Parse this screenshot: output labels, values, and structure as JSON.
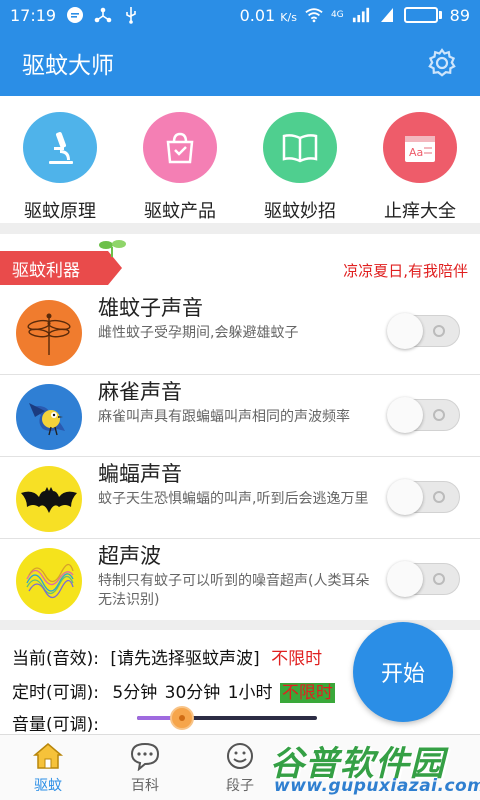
{
  "status_bar": {
    "time": "17:19",
    "speed": "0.01",
    "speed_unit": "K/s",
    "network": "4G",
    "battery_level": 89,
    "battery_text": "89"
  },
  "app_bar": {
    "title": "驱蚊大师"
  },
  "quick_menu": [
    {
      "label": "驱蚊原理",
      "icon": "microscope-icon",
      "color": "#4fb3ea"
    },
    {
      "label": "驱蚊产品",
      "icon": "shopping-bag-icon",
      "color": "#f47fb4"
    },
    {
      "label": "驱蚊妙招",
      "icon": "open-book-icon",
      "color": "#4fcf8f"
    },
    {
      "label": "止痒大全",
      "icon": "notepad-icon",
      "color": "#ee5c6a"
    }
  ],
  "section": {
    "ribbon_label": "驱蚊利器",
    "slogan": "凉凉夏日,有我陪伴",
    "items": [
      {
        "name": "雄蚊子声音",
        "description": "雌性蚊子受孕期间,会躲避雄蚊子",
        "icon": "dragonfly-icon",
        "on": false
      },
      {
        "name": "麻雀声音",
        "description": "麻雀叫声具有跟蝙蝠叫声相同的声波频率",
        "icon": "sparrow-icon",
        "on": false
      },
      {
        "name": "蝙蝠声音",
        "description": "蚊子天生恐惧蝙蝠的叫声,听到后会逃逸万里",
        "icon": "bat-icon",
        "on": false
      },
      {
        "name": "超声波",
        "description": "特制只有蚊子可以听到的噪音超声(人类耳朵无法识别)",
        "icon": "wave-icon",
        "on": false
      }
    ]
  },
  "panel": {
    "current_label": "当前(音效):",
    "current_value": "[请先选择驱蚊声波]",
    "current_limit": "不限时",
    "timer_label": "定时(可调):",
    "timer_options": [
      "5分钟",
      "30分钟",
      "1小时",
      "不限时"
    ],
    "timer_selected": "不限时",
    "volume_label": "音量(可调):",
    "volume_level": 0.25,
    "start_label": "开始"
  },
  "tabs": [
    {
      "label": "驱蚊",
      "icon": "home-icon",
      "active": true
    },
    {
      "label": "百科",
      "icon": "chat-bubble-icon",
      "active": false
    },
    {
      "label": "段子",
      "icon": "smile-icon",
      "active": false
    }
  ],
  "watermark": {
    "line1": "谷普软件园",
    "line2": "www.gupuxiazai.com"
  },
  "colors": {
    "primary": "#2b8ee6",
    "accent_red": "#e02020",
    "ribbon": "#e94b4b",
    "highlight_green": "#3aa83a"
  }
}
